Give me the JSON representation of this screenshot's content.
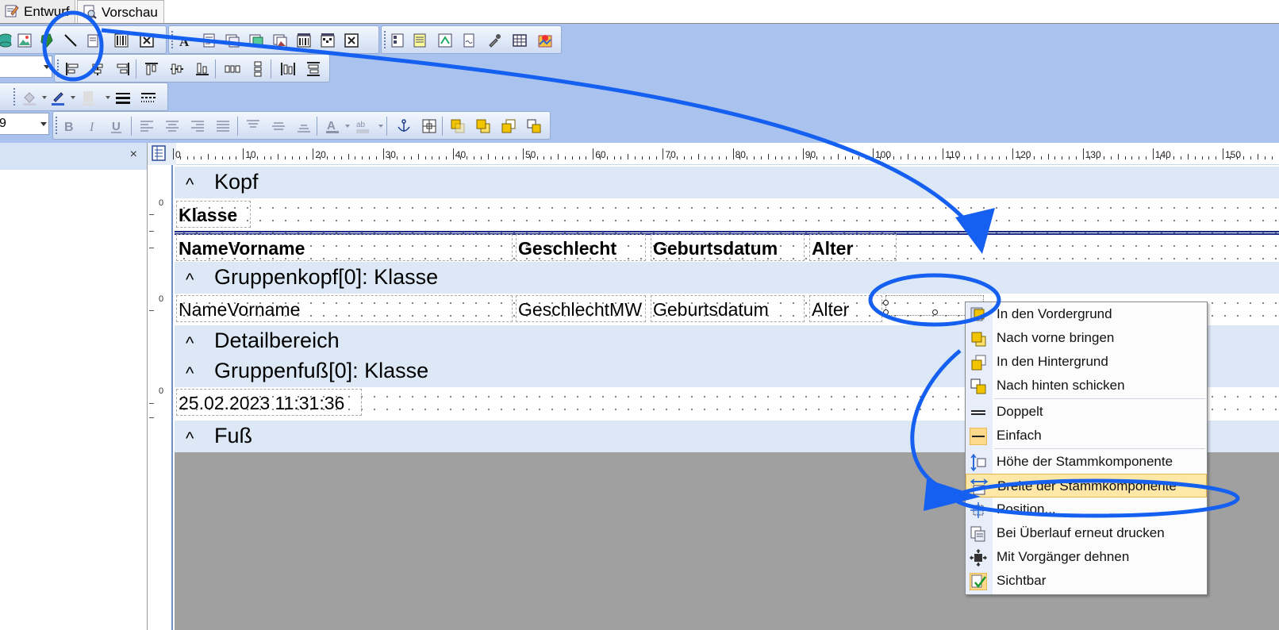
{
  "tabs": [
    {
      "label": "Entwurf",
      "icon": "design-icon"
    },
    {
      "label": "Vorschau",
      "icon": "preview-icon"
    }
  ],
  "left_panel": {
    "close_label": "×"
  },
  "font_size_value": "9",
  "ruler": {
    "labels": [
      "0",
      "10",
      "20",
      "30",
      "40",
      "50",
      "60",
      "70",
      "80",
      "90",
      "100",
      "110",
      "120",
      "130",
      "140",
      "150"
    ]
  },
  "bands": [
    {
      "caret": "^",
      "title": "Kopf"
    },
    {
      "caret": "^",
      "title": "Gruppenkopf[0]: Klasse"
    },
    {
      "caret": "^",
      "title": "Detailbereich"
    },
    {
      "caret": "^",
      "title": "Gruppenfuß[0]: Klasse"
    },
    {
      "caret": "^",
      "title": "Fuß"
    }
  ],
  "header_fields": {
    "klasse": "Klasse",
    "name": "NameVorname",
    "geschlecht": "Geschlecht",
    "geburtsdatum": "Geburtsdatum",
    "alter": "Alter"
  },
  "group_fields": {
    "name": "NameVorname",
    "geschlecht": "GeschlechtMW",
    "geburtsdatum": "Geburtsdatum",
    "alter": "Alter"
  },
  "footer_field": "25.02.2023 11:31:36",
  "vruler_zero": "0",
  "context_menu": {
    "items": [
      {
        "label": "In  den  Vordergrund",
        "icon": "bring-to-front-icon"
      },
      {
        "label": "Nach vorne bringen",
        "icon": "bring-forward-icon"
      },
      {
        "label": "In den Hintergrund",
        "icon": "send-to-back-icon"
      },
      {
        "label": "Nach hinten schicken",
        "icon": "send-backward-icon"
      },
      {
        "label": "Doppelt",
        "icon": "double-line-icon"
      },
      {
        "label": "Einfach",
        "icon": "single-line-icon"
      },
      {
        "label": "Höhe der Stammkomponente",
        "icon": "parent-height-icon"
      },
      {
        "label": "Breite der Stammkomponente",
        "icon": "parent-width-icon"
      },
      {
        "label": "Position...",
        "icon": "position-icon"
      },
      {
        "label": "Bei Überlauf erneut drucken",
        "icon": "reprint-on-overflow-icon"
      },
      {
        "label": "Mit Vorgänger dehnen",
        "icon": "stretch-with-parent-icon"
      },
      {
        "label": "Sichtbar",
        "icon": "visible-check-icon"
      }
    ]
  },
  "colors": {
    "toolbar_bg": "#a9c3ee",
    "band_bg": "#dde8f7",
    "menu_highlight": "#ffe7a8",
    "annotation_blue": "#1560f0",
    "double_line": "#1b2a88"
  }
}
